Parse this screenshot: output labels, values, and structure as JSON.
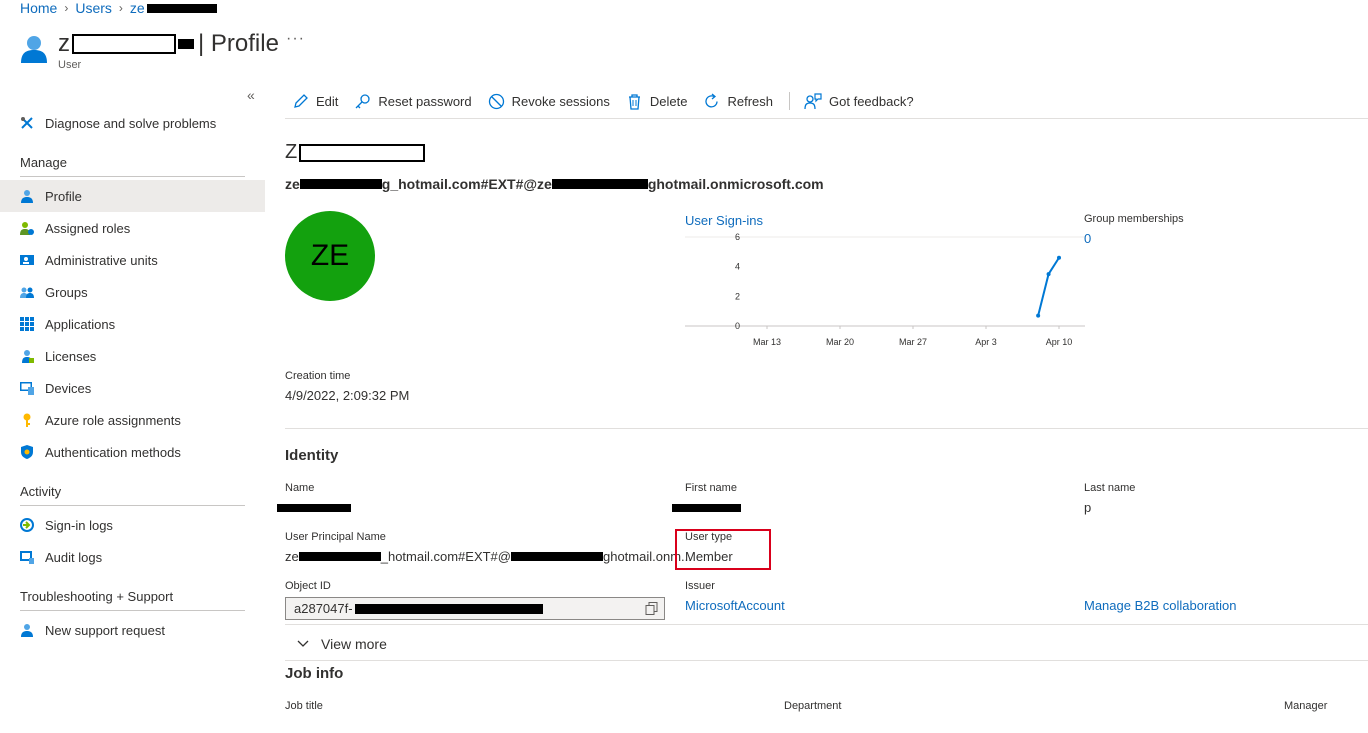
{
  "breadcrumb": {
    "home": "Home",
    "users": "Users",
    "current": "ze"
  },
  "header": {
    "title_prefix": "z",
    "title_suffix": "| Profile",
    "subtitle": "User",
    "more": "···"
  },
  "sidebar": {
    "collapse": "«",
    "diagnose": "Diagnose and solve problems",
    "section_manage": "Manage",
    "manage_items": [
      "Profile",
      "Assigned roles",
      "Administrative units",
      "Groups",
      "Applications",
      "Licenses",
      "Devices",
      "Azure role assignments",
      "Authentication methods"
    ],
    "section_activity": "Activity",
    "activity_items": [
      "Sign-in logs",
      "Audit logs"
    ],
    "section_support": "Troubleshooting + Support",
    "support_items": [
      "New support request"
    ]
  },
  "toolbar": {
    "edit": "Edit",
    "reset_password": "Reset password",
    "revoke_sessions": "Revoke sessions",
    "delete": "Delete",
    "refresh": "Refresh",
    "feedback": "Got feedback?"
  },
  "user": {
    "name_prefix": "Z",
    "upn_prefix": "ze",
    "upn_mid": "g_hotmail.com#EXT#@ze",
    "upn_suffix": "ghotmail.onmicrosoft.com",
    "initials": "ZE",
    "creation_label": "Creation time",
    "creation_value": "4/9/2022, 2:09:32 PM"
  },
  "chart_data": {
    "type": "line",
    "title": "User Sign-ins",
    "x": [
      "Apr 8",
      "Apr 9",
      "Apr 10"
    ],
    "series": [
      {
        "values": [
          0.7,
          3.5,
          4.6
        ]
      }
    ],
    "x_ticks": [
      "Mar 13",
      "Mar 20",
      "Mar 27",
      "Apr 3",
      "Apr 10"
    ],
    "y_ticks": [
      "6",
      "4",
      "2",
      "0"
    ],
    "ylim": [
      0,
      6
    ],
    "color": "#0078d4"
  },
  "groups": {
    "label": "Group memberships",
    "value": "0"
  },
  "identity": {
    "heading": "Identity",
    "name_label": "Name",
    "first_name_label": "First name",
    "last_name_label": "Last name",
    "last_name_value": "p",
    "upn_label": "User Principal Name",
    "upn_prefix": "ze",
    "upn_mid": "_hotmail.com#EXT#@",
    "upn_suffix": "ghotmail.onm...",
    "user_type_label": "User type",
    "user_type_value": "Member",
    "object_id_label": "Object ID",
    "object_id_prefix": "a287047f-",
    "issuer_label": "Issuer",
    "issuer_value": "MicrosoftAccount",
    "b2b_link": "Manage B2B collaboration",
    "view_more": "View more"
  },
  "job_info": {
    "heading": "Job info",
    "job_title_label": "Job title",
    "department_label": "Department",
    "manager_label": "Manager"
  },
  "colors": {
    "accent": "#0078d4",
    "avatar": "#13a10e",
    "highlight": "#d9001b"
  }
}
